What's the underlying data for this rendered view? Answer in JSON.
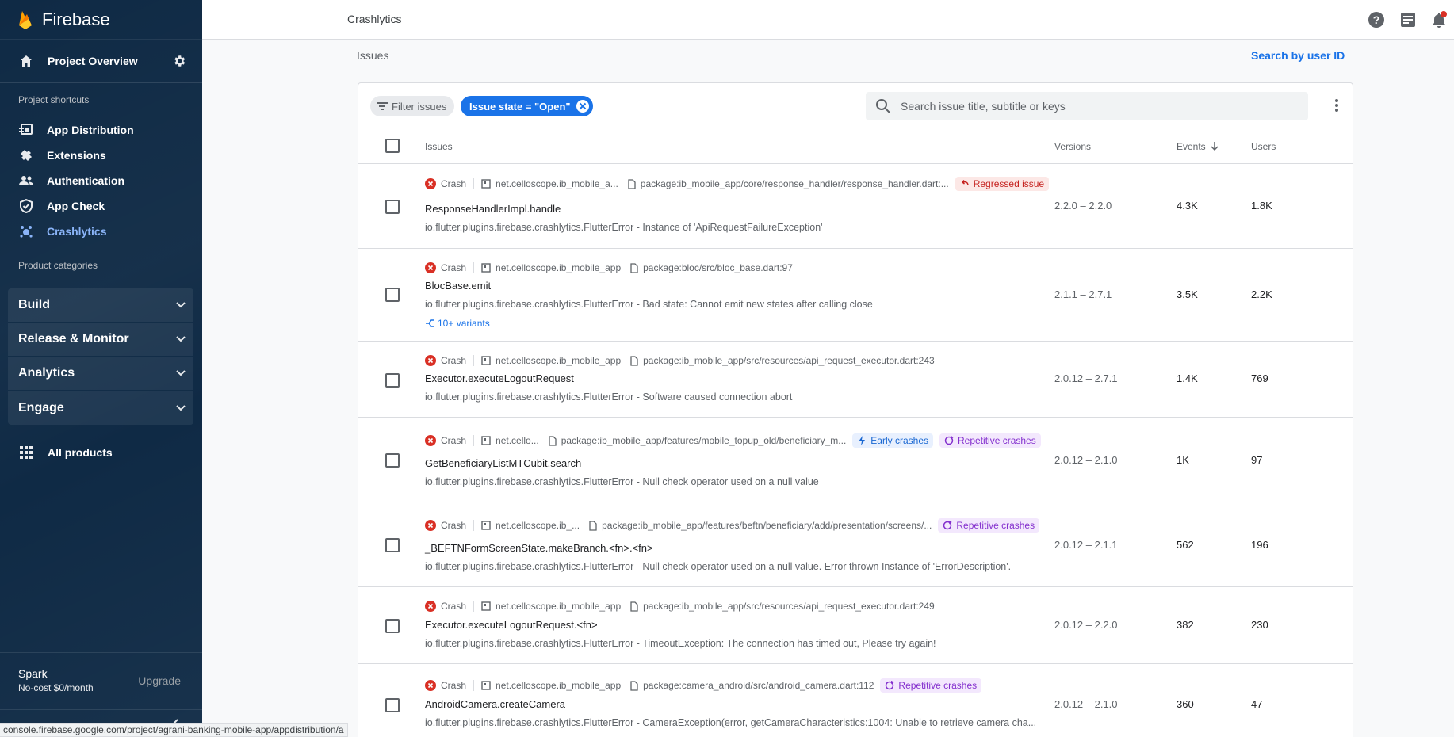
{
  "app": {
    "brand": "Firebase"
  },
  "sidebar": {
    "project_overview": "Project Overview",
    "shortcuts_title": "Project shortcuts",
    "shortcuts": [
      {
        "label": "App Distribution",
        "icon": "app-distribution-icon"
      },
      {
        "label": "Extensions",
        "icon": "extensions-icon"
      },
      {
        "label": "Authentication",
        "icon": "authentication-icon"
      },
      {
        "label": "App Check",
        "icon": "app-check-icon"
      },
      {
        "label": "Crashlytics",
        "icon": "crashlytics-icon",
        "active": true
      }
    ],
    "categories_title": "Product categories",
    "categories": [
      {
        "label": "Build"
      },
      {
        "label": "Release & Monitor"
      },
      {
        "label": "Analytics"
      },
      {
        "label": "Engage"
      }
    ],
    "all_products": "All products",
    "plan": {
      "name": "Spark",
      "desc": "No-cost $0/month",
      "upgrade": "Upgrade"
    }
  },
  "topbar": {
    "title": "Crashlytics"
  },
  "content": {
    "breadcrumb": "Issues",
    "search_by_user": "Search by user ID",
    "filter_label": "Filter issues",
    "active_filter": "Issue state = \"Open\"",
    "search_placeholder": "Search issue title, subtitle or keys",
    "columns": {
      "issues": "Issues",
      "versions": "Versions",
      "events": "Events",
      "users": "Users"
    },
    "rows": [
      {
        "type": "Crash",
        "app": "net.celloscope.ib_mobile_a...",
        "file": "package:ib_mobile_app/core/response_handler/response_handler.dart:...",
        "badges": [
          {
            "kind": "regressed",
            "label": "Regressed issue"
          }
        ],
        "title": "ResponseHandlerImpl.handle",
        "subtitle": "io.flutter.plugins.firebase.crashlytics.FlutterError - Instance of 'ApiRequestFailureException'",
        "versions": "2.2.0 – 2.2.0",
        "events": "4.3K",
        "users": "1.8K"
      },
      {
        "type": "Crash",
        "app": "net.celloscope.ib_mobile_app",
        "file": "package:bloc/src/bloc_base.dart:97",
        "badges": [],
        "title": "BlocBase.emit",
        "subtitle": "io.flutter.plugins.firebase.crashlytics.FlutterError - Bad state: Cannot emit new states after calling close",
        "variants": "10+ variants",
        "versions": "2.1.1 – 2.7.1",
        "events": "3.5K",
        "users": "2.2K"
      },
      {
        "type": "Crash",
        "app": "net.celloscope.ib_mobile_app",
        "file": "package:ib_mobile_app/src/resources/api_request_executor.dart:243",
        "badges": [],
        "title": "Executor.executeLogoutRequest",
        "subtitle": "io.flutter.plugins.firebase.crashlytics.FlutterError - Software caused connection abort",
        "versions": "2.0.12 – 2.7.1",
        "events": "1.4K",
        "users": "769"
      },
      {
        "type": "Crash",
        "app": "net.cello...",
        "file": "package:ib_mobile_app/features/mobile_topup_old/beneficiary_m...",
        "badges": [
          {
            "kind": "early",
            "label": "Early crashes"
          },
          {
            "kind": "repetitive",
            "label": "Repetitive crashes"
          }
        ],
        "title": "GetBeneficiaryListMTCubit.search",
        "subtitle": "io.flutter.plugins.firebase.crashlytics.FlutterError - Null check operator used on a null value",
        "versions": "2.0.12 – 2.1.0",
        "events": "1K",
        "users": "97"
      },
      {
        "type": "Crash",
        "app": "net.celloscope.ib_...",
        "file": "package:ib_mobile_app/features/beftn/beneficiary/add/presentation/screens/...",
        "badges": [
          {
            "kind": "repetitive",
            "label": "Repetitive crashes"
          }
        ],
        "title": "_BEFTNFormScreenState.makeBranch.<fn>.<fn>",
        "subtitle": "io.flutter.plugins.firebase.crashlytics.FlutterError - Null check operator used on a null value. Error thrown Instance of 'ErrorDescription'.",
        "versions": "2.0.12 – 2.1.1",
        "events": "562",
        "users": "196"
      },
      {
        "type": "Crash",
        "app": "net.celloscope.ib_mobile_app",
        "file": "package:ib_mobile_app/src/resources/api_request_executor.dart:249",
        "badges": [],
        "title": "Executor.executeLogoutRequest.<fn>",
        "subtitle": "io.flutter.plugins.firebase.crashlytics.FlutterError - TimeoutException: The connection has timed out, Please try again!",
        "versions": "2.0.12 – 2.2.0",
        "events": "382",
        "users": "230"
      },
      {
        "type": "Crash",
        "app": "net.celloscope.ib_mobile_app",
        "file": "package:camera_android/src/android_camera.dart:112",
        "badges": [
          {
            "kind": "repetitive",
            "label": "Repetitive crashes"
          }
        ],
        "title": "AndroidCamera.createCamera",
        "subtitle": "io.flutter.plugins.firebase.crashlytics.FlutterError - CameraException(error, getCameraCharacteristics:1004: Unable to retrieve camera cha...",
        "versions": "2.0.12 – 2.1.0",
        "events": "360",
        "users": "47"
      }
    ]
  },
  "statusbar": "console.firebase.google.com/project/agrani-banking-mobile-app/appdistribution/a",
  "colors": {
    "sidebar_bg": "#0f2a45",
    "accent": "#1a73e8",
    "error_red": "#d93025",
    "regressed_bg": "#fce8e6",
    "early_bg": "#e8f0fe",
    "repetitive_bg": "#f3e8fd"
  }
}
